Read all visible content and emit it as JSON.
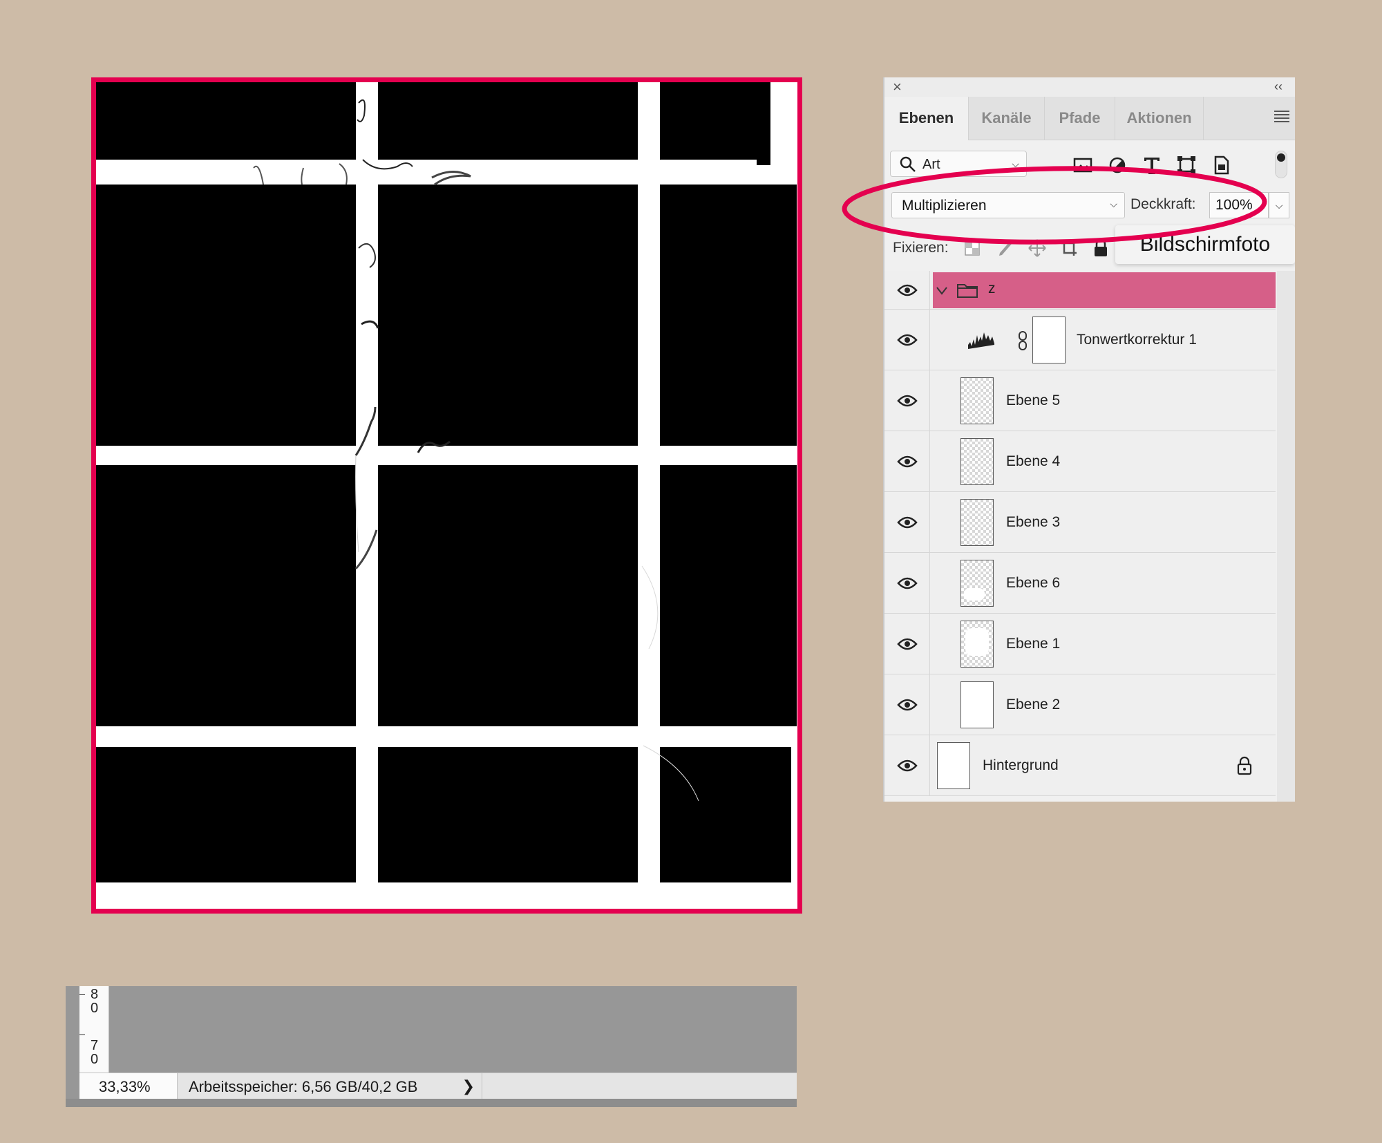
{
  "panel": {
    "tabs": [
      "Ebenen",
      "Kanäle",
      "Pfade",
      "Aktionen"
    ],
    "active_tab": "Ebenen",
    "filter": {
      "label": "Art"
    },
    "blend_mode": "Multiplizieren",
    "opacity_label": "Deckkraft:",
    "opacity_value": "100%",
    "lock_label": "Fixieren:",
    "tooltip": "Bildschirmfoto",
    "layers": [
      {
        "name": "z",
        "type": "group",
        "visible": true,
        "expanded": true,
        "selected": true
      },
      {
        "name": "Tonwertkorrektur 1",
        "type": "adjustment",
        "visible": true
      },
      {
        "name": "Ebene 5",
        "type": "pixel",
        "visible": true
      },
      {
        "name": "Ebene 4",
        "type": "pixel",
        "visible": true
      },
      {
        "name": "Ebene 3",
        "type": "pixel",
        "visible": true
      },
      {
        "name": "Ebene 6",
        "type": "pixel",
        "visible": true
      },
      {
        "name": "Ebene 1",
        "type": "pixel",
        "visible": true
      },
      {
        "name": "Ebene 2",
        "type": "pixel",
        "visible": true
      },
      {
        "name": "Hintergrund",
        "type": "background",
        "visible": true,
        "locked": true
      }
    ]
  },
  "ruler": {
    "marks": [
      [
        "8",
        "0"
      ],
      [
        "7",
        "0"
      ]
    ]
  },
  "status": {
    "zoom": "33,33%",
    "memory": "Arbeitsspeicher: 6,56 GB/40,2 GB",
    "arrow": "❯"
  },
  "colors": {
    "background": "#cdbba7",
    "canvas_border": "#e4004f",
    "selected_group": "#d65f88",
    "annotation": "#e4004f"
  }
}
